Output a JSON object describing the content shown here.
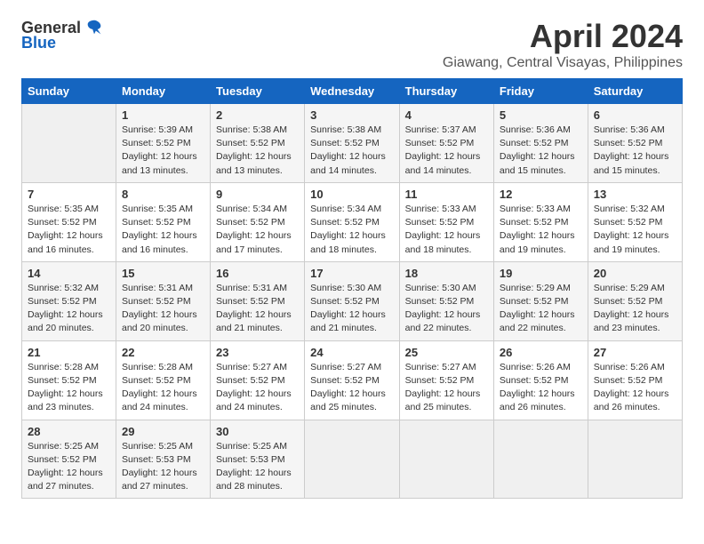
{
  "logo": {
    "general": "General",
    "blue": "Blue"
  },
  "title": "April 2024",
  "location": "Giawang, Central Visayas, Philippines",
  "weekdays": [
    "Sunday",
    "Monday",
    "Tuesday",
    "Wednesday",
    "Thursday",
    "Friday",
    "Saturday"
  ],
  "weeks": [
    [
      {
        "day": "",
        "info": ""
      },
      {
        "day": "1",
        "info": "Sunrise: 5:39 AM\nSunset: 5:52 PM\nDaylight: 12 hours\nand 13 minutes."
      },
      {
        "day": "2",
        "info": "Sunrise: 5:38 AM\nSunset: 5:52 PM\nDaylight: 12 hours\nand 13 minutes."
      },
      {
        "day": "3",
        "info": "Sunrise: 5:38 AM\nSunset: 5:52 PM\nDaylight: 12 hours\nand 14 minutes."
      },
      {
        "day": "4",
        "info": "Sunrise: 5:37 AM\nSunset: 5:52 PM\nDaylight: 12 hours\nand 14 minutes."
      },
      {
        "day": "5",
        "info": "Sunrise: 5:36 AM\nSunset: 5:52 PM\nDaylight: 12 hours\nand 15 minutes."
      },
      {
        "day": "6",
        "info": "Sunrise: 5:36 AM\nSunset: 5:52 PM\nDaylight: 12 hours\nand 15 minutes."
      }
    ],
    [
      {
        "day": "7",
        "info": "Sunrise: 5:35 AM\nSunset: 5:52 PM\nDaylight: 12 hours\nand 16 minutes."
      },
      {
        "day": "8",
        "info": "Sunrise: 5:35 AM\nSunset: 5:52 PM\nDaylight: 12 hours\nand 16 minutes."
      },
      {
        "day": "9",
        "info": "Sunrise: 5:34 AM\nSunset: 5:52 PM\nDaylight: 12 hours\nand 17 minutes."
      },
      {
        "day": "10",
        "info": "Sunrise: 5:34 AM\nSunset: 5:52 PM\nDaylight: 12 hours\nand 18 minutes."
      },
      {
        "day": "11",
        "info": "Sunrise: 5:33 AM\nSunset: 5:52 PM\nDaylight: 12 hours\nand 18 minutes."
      },
      {
        "day": "12",
        "info": "Sunrise: 5:33 AM\nSunset: 5:52 PM\nDaylight: 12 hours\nand 19 minutes."
      },
      {
        "day": "13",
        "info": "Sunrise: 5:32 AM\nSunset: 5:52 PM\nDaylight: 12 hours\nand 19 minutes."
      }
    ],
    [
      {
        "day": "14",
        "info": "Sunrise: 5:32 AM\nSunset: 5:52 PM\nDaylight: 12 hours\nand 20 minutes."
      },
      {
        "day": "15",
        "info": "Sunrise: 5:31 AM\nSunset: 5:52 PM\nDaylight: 12 hours\nand 20 minutes."
      },
      {
        "day": "16",
        "info": "Sunrise: 5:31 AM\nSunset: 5:52 PM\nDaylight: 12 hours\nand 21 minutes."
      },
      {
        "day": "17",
        "info": "Sunrise: 5:30 AM\nSunset: 5:52 PM\nDaylight: 12 hours\nand 21 minutes."
      },
      {
        "day": "18",
        "info": "Sunrise: 5:30 AM\nSunset: 5:52 PM\nDaylight: 12 hours\nand 22 minutes."
      },
      {
        "day": "19",
        "info": "Sunrise: 5:29 AM\nSunset: 5:52 PM\nDaylight: 12 hours\nand 22 minutes."
      },
      {
        "day": "20",
        "info": "Sunrise: 5:29 AM\nSunset: 5:52 PM\nDaylight: 12 hours\nand 23 minutes."
      }
    ],
    [
      {
        "day": "21",
        "info": "Sunrise: 5:28 AM\nSunset: 5:52 PM\nDaylight: 12 hours\nand 23 minutes."
      },
      {
        "day": "22",
        "info": "Sunrise: 5:28 AM\nSunset: 5:52 PM\nDaylight: 12 hours\nand 24 minutes."
      },
      {
        "day": "23",
        "info": "Sunrise: 5:27 AM\nSunset: 5:52 PM\nDaylight: 12 hours\nand 24 minutes."
      },
      {
        "day": "24",
        "info": "Sunrise: 5:27 AM\nSunset: 5:52 PM\nDaylight: 12 hours\nand 25 minutes."
      },
      {
        "day": "25",
        "info": "Sunrise: 5:27 AM\nSunset: 5:52 PM\nDaylight: 12 hours\nand 25 minutes."
      },
      {
        "day": "26",
        "info": "Sunrise: 5:26 AM\nSunset: 5:52 PM\nDaylight: 12 hours\nand 26 minutes."
      },
      {
        "day": "27",
        "info": "Sunrise: 5:26 AM\nSunset: 5:52 PM\nDaylight: 12 hours\nand 26 minutes."
      }
    ],
    [
      {
        "day": "28",
        "info": "Sunrise: 5:25 AM\nSunset: 5:52 PM\nDaylight: 12 hours\nand 27 minutes."
      },
      {
        "day": "29",
        "info": "Sunrise: 5:25 AM\nSunset: 5:53 PM\nDaylight: 12 hours\nand 27 minutes."
      },
      {
        "day": "30",
        "info": "Sunrise: 5:25 AM\nSunset: 5:53 PM\nDaylight: 12 hours\nand 28 minutes."
      },
      {
        "day": "",
        "info": ""
      },
      {
        "day": "",
        "info": ""
      },
      {
        "day": "",
        "info": ""
      },
      {
        "day": "",
        "info": ""
      }
    ]
  ]
}
